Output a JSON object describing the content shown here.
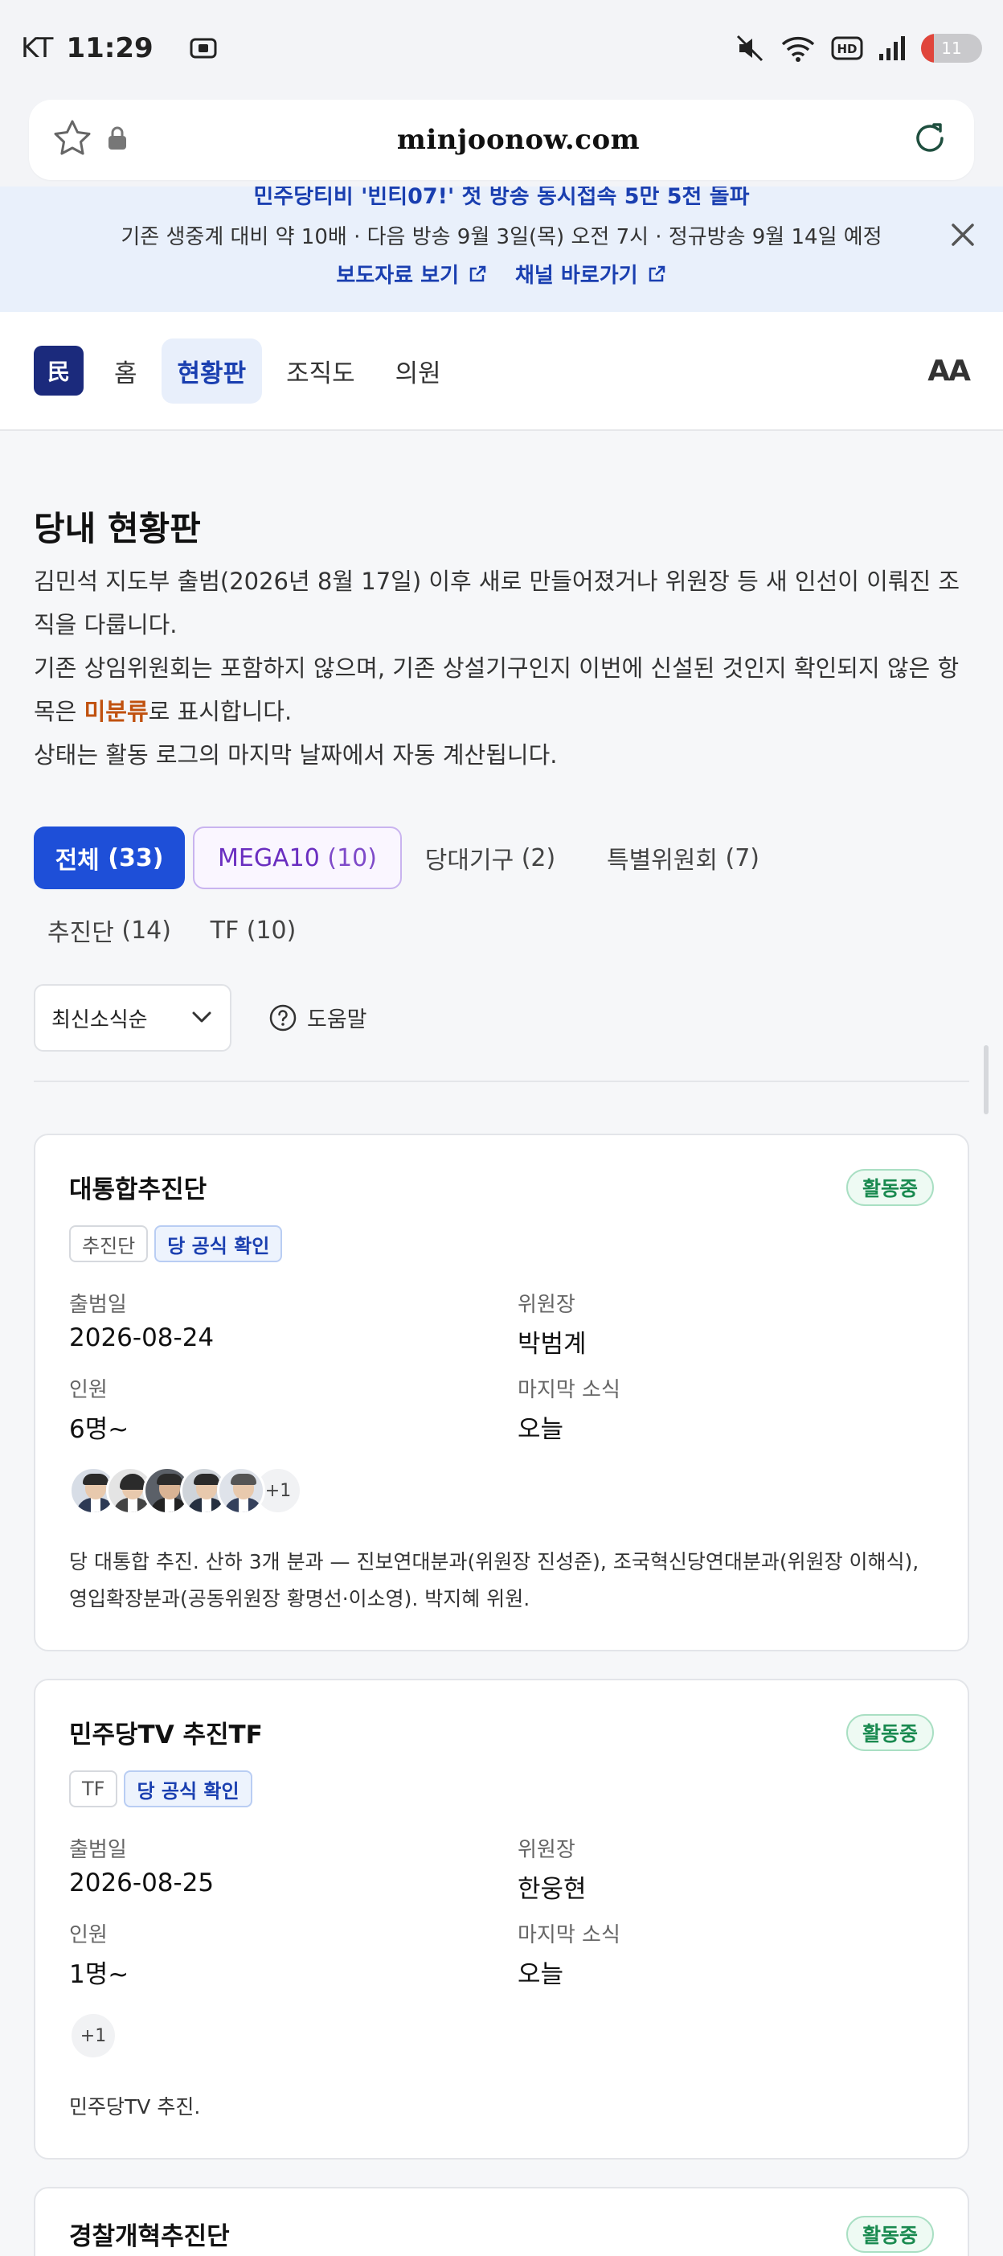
{
  "statusbar": {
    "carrier": "KT",
    "time": "11:29",
    "battery": "11"
  },
  "browser": {
    "url": "minjoonow.com"
  },
  "banner": {
    "headline": "민주당티비 '빈티07!' 첫 방송 동시접속 5만 5천 돌파",
    "detail": "기존 생중계 대비 약 10배 · 다음 방송 9월 3일(목) 오전 7시 · 정규방송 9월 14일 예정",
    "link_press": "보도자료 보기",
    "link_channel": "채널 바로가기"
  },
  "nav": {
    "logo": "民",
    "items": [
      {
        "label": "홈"
      },
      {
        "label": "현황판"
      },
      {
        "label": "조직도"
      },
      {
        "label": "의원"
      }
    ],
    "font_size_label": "AA"
  },
  "page": {
    "title": "당내 현황판",
    "desc_line1": "김민석 지도부 출범(2026년 8월 17일) 이후 새로 만들어졌거나 위원장 등 새 인선이 이뤄진 조직을 다룹니다.",
    "desc_line2_pre": "기존 상임위원회는 포함하지 않으며, 기존 상설기구인지 이번에 신설된 것인지 확인되지 않은 항목은 ",
    "desc_line2_hl": "미분류",
    "desc_line2_post": "로 표시합니다.",
    "desc_line3": "상태는 활동 로그의 마지막 날짜에서 자동 계산됩니다."
  },
  "filters": [
    {
      "label": "전체",
      "count": "(33)"
    },
    {
      "label": "MEGA10",
      "count": "(10)"
    },
    {
      "label": "당대기구",
      "count": "(2)"
    },
    {
      "label": "특별위원회",
      "count": "(7)"
    },
    {
      "label": "추진단",
      "count": "(14)"
    },
    {
      "label": "TF",
      "count": "(10)"
    }
  ],
  "sort": {
    "selected": "최신소식순",
    "help_label": "도움말"
  },
  "labels": {
    "launch_date": "출범일",
    "chair": "위원장",
    "members": "인원",
    "last_news": "마지막 소식"
  },
  "cards": [
    {
      "name": "대통합추진단",
      "status": "활동중",
      "type_tag": "추진단",
      "confirm_tag": "당 공식 확인",
      "launch_date": "2026-08-24",
      "chair": "박범계",
      "members": "6명~",
      "last_news": "오늘",
      "extra_count": "+1",
      "description": "당 대통합 추진. 산하 3개 분과 — 진보연대분과(위원장 진성준), 조국혁신당연대분과(위원장 이해식), 영입확장분과(공동위원장 황명선·이소영). 박지혜 위원."
    },
    {
      "name": "민주당TV 추진TF",
      "status": "활동중",
      "type_tag": "TF",
      "confirm_tag": "당 공식 확인",
      "launch_date": "2026-08-25",
      "chair": "한웅현",
      "members": "1명~",
      "last_news": "오늘",
      "extra_count": "+1",
      "description": "민주당TV 추진."
    },
    {
      "name": "경찰개혁추진단",
      "status": "활동중"
    }
  ],
  "colors": {
    "primary": "#1e4fd8",
    "brand_navy": "#1b2a7c",
    "mega_purple": "#6a2ec0",
    "status_green": "#1a8a50",
    "highlight_orange": "#c0510f",
    "banner_bg": "#e9f0fb"
  }
}
